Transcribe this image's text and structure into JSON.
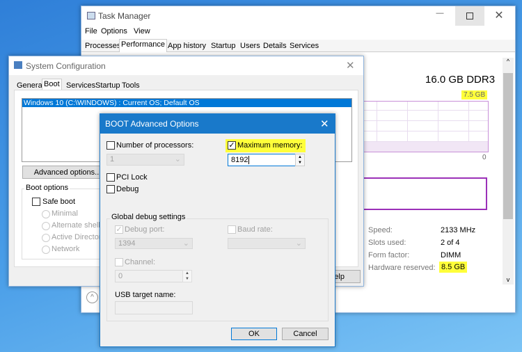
{
  "task_manager": {
    "title": "Task Manager",
    "menu": [
      "File",
      "Options",
      "View"
    ],
    "tabs": [
      "Processes",
      "Performance",
      "App history",
      "Startup",
      "Users",
      "Details",
      "Services"
    ],
    "active_tab": "Performance",
    "memory_type": "16.0 GB DDR3",
    "graph_max": "7.5 GB",
    "graph_min": "0",
    "stats": [
      {
        "label": "Speed:",
        "value": "2133 MHz"
      },
      {
        "label": "Slots used:",
        "value": "2 of 4"
      },
      {
        "label": "Form factor:",
        "value": "DIMM"
      },
      {
        "label": "Hardware reserved:",
        "value": "8.5 GB"
      }
    ],
    "highlight_color": "#ffff3a",
    "graph_color": "#9b30b8"
  },
  "sysconfig": {
    "title": "System Configuration",
    "tabs": [
      "General",
      "Boot",
      "Services",
      "Startup",
      "Tools"
    ],
    "active_tab": "Boot",
    "boot_entry": "Windows 10 (C:\\WINDOWS) : Current OS; Default OS",
    "advanced_button": "Advanced options...",
    "boot_options_label": "Boot options",
    "safe_boot": "Safe boot",
    "safe_boot_modes": [
      "Minimal",
      "Alternate shell",
      "Active Directory",
      "Network"
    ],
    "help_button": "elp"
  },
  "advanced": {
    "title": "BOOT Advanced Options",
    "num_processors_label": "Number of processors:",
    "num_processors_value": "1",
    "max_memory_label": "Maximum memory:",
    "max_memory_checked": true,
    "max_memory_value": "8192",
    "pci_lock": "PCI Lock",
    "debug": "Debug",
    "global_debug": "Global debug settings",
    "debug_port_label": "Debug port:",
    "debug_port_value": "1394",
    "baud_rate_label": "Baud rate:",
    "channel_label": "Channel:",
    "channel_value": "0",
    "usb_target_label": "USB target name:",
    "ok": "OK",
    "cancel": "Cancel",
    "title_color": "#1979ca"
  }
}
